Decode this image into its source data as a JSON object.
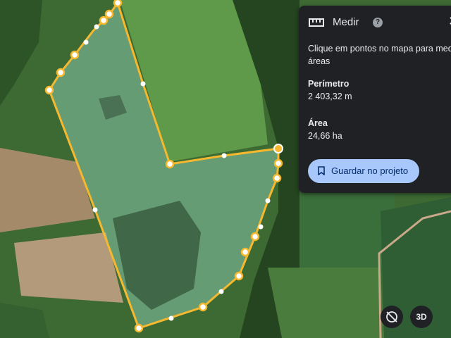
{
  "measure_panel": {
    "title": "Medir",
    "help_icon": "?",
    "instructions": "Clique em pontos no mapa para medir áreas",
    "perimeter_label": "Perímetro",
    "perimeter_value": "2 403,32 m",
    "area_label": "Área",
    "area_value": "24,66 ha",
    "save_button": "Guardar no projeto",
    "icons": [
      "ruler-icon",
      "help-icon",
      "close-icon",
      "bookmark-icon"
    ]
  },
  "map_controls": {
    "view_3d": "3D",
    "icons": [
      "compass-icon"
    ]
  },
  "colors": {
    "measure_line": "#f5b82e",
    "area_fill": "#9ad9c0",
    "panel_bg": "#202124",
    "button_bg": "#a8c7fa"
  }
}
